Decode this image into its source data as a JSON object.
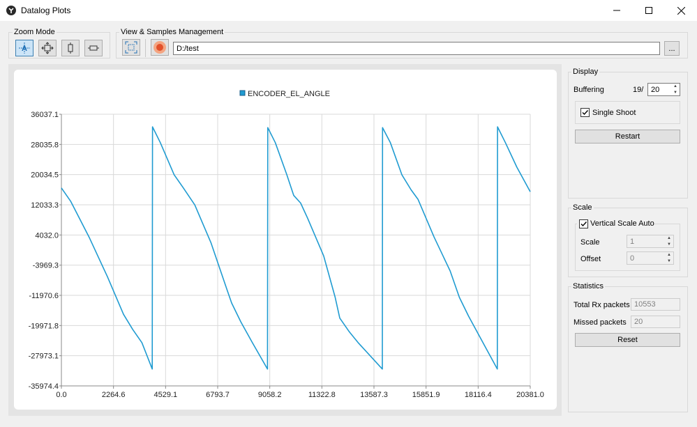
{
  "window": {
    "title": "Datalog Plots"
  },
  "toolbar": {
    "zoom_mode_label": "Zoom Mode",
    "view_mgmt_label": "View & Samples Management",
    "path_value": "D:/test",
    "browse_label": "..."
  },
  "display": {
    "title": "Display",
    "buffering_label": "Buffering",
    "buffering_current": "19/",
    "buffering_value": "20",
    "single_shoot_label": "Single Shoot",
    "single_shoot_checked": true,
    "restart_label": "Restart"
  },
  "scale": {
    "title": "Scale",
    "vertical_auto_label": "Vertical Scale Auto",
    "vertical_auto_checked": true,
    "scale_label": "Scale",
    "scale_value": "1",
    "offset_label": "Offset",
    "offset_value": "0"
  },
  "statistics": {
    "title": "Statistics",
    "total_rx_label": "Total Rx packets",
    "total_rx_value": "10553",
    "missed_label": "Missed packets",
    "missed_value": "20",
    "reset_label": "Reset"
  },
  "chart_data": {
    "type": "line",
    "legend": [
      "ENCODER_EL_ANGLE"
    ],
    "legend_placement": "top-center",
    "grid": true,
    "series_color": "#1f9bd1",
    "xlim": [
      0,
      20381.0
    ],
    "ylim": [
      -35974.4,
      36037.1
    ],
    "x_ticks": [
      "0.0",
      "2264.6",
      "4529.1",
      "6793.7",
      "9058.2",
      "11322.8",
      "13587.3",
      "15851.9",
      "18116.4",
      "20381.0"
    ],
    "y_ticks": [
      "36037.1",
      "28035.8",
      "20034.5",
      "12033.3",
      "4032.0",
      "-3969.3",
      "-11970.6",
      "-19971.8",
      "-27973.1",
      "-35974.4"
    ],
    "series": [
      {
        "name": "ENCODER_EL_ANGLE",
        "x": [
          0,
          400,
          1200,
          2000,
          2700,
          3100,
          3500,
          3950,
          3960,
          4300,
          4900,
          5300,
          5800,
          6500,
          7200,
          7400,
          7800,
          8300,
          8960,
          8970,
          9300,
          9800,
          10100,
          10400,
          10700,
          11400,
          11900,
          12100,
          12500,
          12900,
          13950,
          13960,
          14300,
          14800,
          15200,
          15500,
          16200,
          16900,
          17300,
          17700,
          18950,
          18960,
          19300,
          19800,
          20381
        ],
        "y": [
          16500,
          13000,
          3500,
          -7000,
          -17000,
          -21000,
          -24500,
          -31500,
          32700,
          28500,
          20000,
          16500,
          12000,
          2000,
          -10500,
          -14000,
          -19000,
          -24500,
          -31500,
          32500,
          28500,
          20000,
          14500,
          12500,
          8500,
          -1500,
          -12500,
          -18000,
          -21500,
          -24500,
          -31500,
          32500,
          28500,
          20000,
          16000,
          13500,
          3500,
          -5500,
          -12500,
          -17500,
          -31500,
          32700,
          28500,
          22000,
          15500
        ]
      }
    ]
  }
}
